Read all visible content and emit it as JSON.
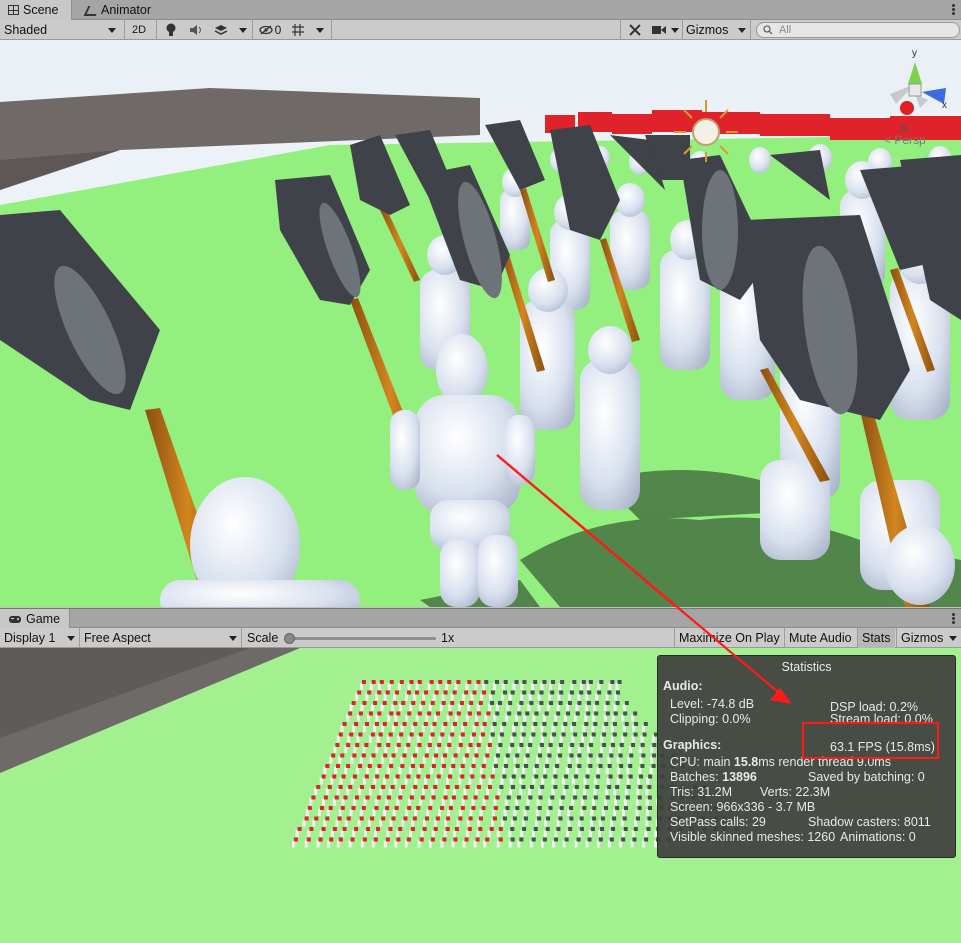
{
  "scene_window": {
    "tabs": [
      {
        "label": "Scene",
        "icon": "grid-icon",
        "active": true
      },
      {
        "label": "Animator",
        "icon": "animator-icon",
        "active": false
      }
    ],
    "toolbar": {
      "draw_mode": "Shaded",
      "mode_2d": "2D",
      "hidden_count": "0",
      "gizmos_label": "Gizmos",
      "search_placeholder": "All"
    },
    "axis_gizmo": {
      "y_label": "y",
      "x_label": "x",
      "projection_label": "< Persp"
    }
  },
  "game_window": {
    "tab_label": "Game",
    "toolbar": {
      "display": "Display 1",
      "aspect": "Free Aspect",
      "scale_label": "Scale",
      "scale_value": "1x",
      "maximize_label": "Maximize On Play",
      "mute_label": "Mute Audio",
      "stats_label": "Stats",
      "gizmos_label": "Gizmos"
    }
  },
  "statistics": {
    "title": "Statistics",
    "audio_header": "Audio:",
    "audio_level": "Level: -74.8 dB",
    "audio_clipping": "Clipping: 0.0%",
    "dsp_load": "DSP load: 0.2%",
    "stream_load": "Stream load: 0.0%",
    "fps": "63.1 FPS (15.8ms)",
    "graphics_header": "Graphics:",
    "cpu_prefix": "CPU: main ",
    "cpu_main": "15.8",
    "cpu_suffix": "ms  render thread 9.0ms",
    "batches_prefix": "Batches: ",
    "batches": "13896",
    "saved_by_batching": "Saved by batching: 0",
    "tris": "Tris: 31.2M",
    "verts": "Verts: 22.3M",
    "screen": "Screen: 966x336 - 3.7 MB",
    "setpass": "SetPass calls: 29",
    "shadow_casters": "Shadow casters: 8011",
    "skinned_meshes": "Visible skinned meshes: 1260",
    "animations": "Animations: 0"
  },
  "colors": {
    "annotation_red": "#ff1a1a",
    "ground_green": "#94f07e",
    "sky": "#f2f6fa",
    "stats_bg": "#404040"
  }
}
